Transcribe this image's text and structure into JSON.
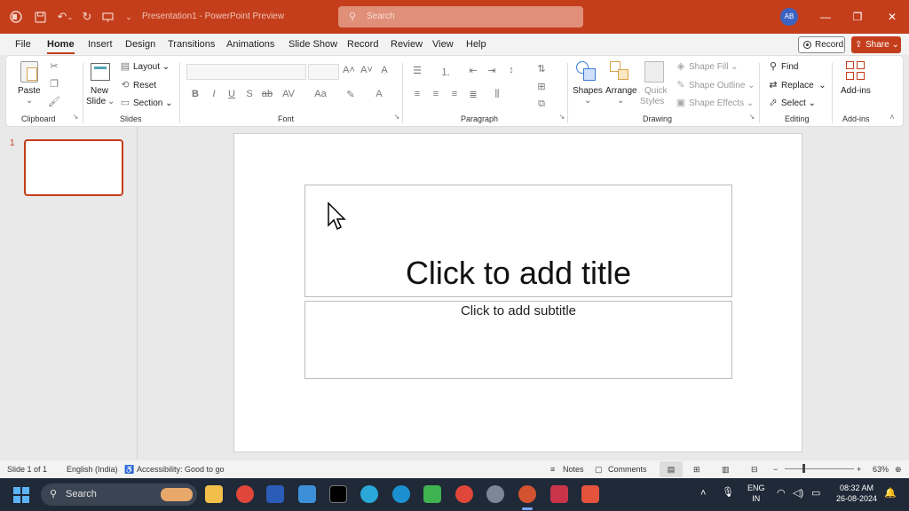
{
  "app": {
    "doc_title": "Presentation1  -  PowerPoint Preview",
    "search_placeholder": "Search",
    "avatar_initials": "AB",
    "accent": "#c43e1c"
  },
  "tabs": [
    "File",
    "Home",
    "Insert",
    "Design",
    "Transitions",
    "Animations",
    "Slide Show",
    "Record",
    "Review",
    "View",
    "Help"
  ],
  "actions": {
    "record": "Record",
    "share": "Share"
  },
  "ribbon": {
    "clipboard": {
      "label": "Clipboard",
      "paste": "Paste"
    },
    "slides": {
      "label": "Slides",
      "new_slide_1": "New",
      "new_slide_2": "Slide",
      "layout": "Layout",
      "reset": "Reset",
      "section": "Section"
    },
    "font": {
      "label": "Font"
    },
    "paragraph": {
      "label": "Paragraph"
    },
    "drawing": {
      "label": "Drawing",
      "shapes": "Shapes",
      "arrange": "Arrange",
      "quick_1": "Quick",
      "quick_2": "Styles",
      "shape_fill": "Shape Fill",
      "shape_outline": "Shape Outline",
      "shape_effects": "Shape Effects"
    },
    "editing": {
      "label": "Editing",
      "find": "Find",
      "replace": "Replace",
      "select": "Select"
    },
    "addins": {
      "label": "Add-ins",
      "addins": "Add-ins"
    }
  },
  "slide_panel": {
    "number": "1"
  },
  "slide": {
    "title_placeholder": "Click to add title",
    "subtitle_placeholder": "Click to add subtitle"
  },
  "status": {
    "slide": "Slide 1 of 1",
    "language": "English (India)",
    "accessibility": "Accessibility: Good to go",
    "notes": "Notes",
    "comments": "Comments",
    "zoom": "63%"
  },
  "taskbar": {
    "search": "Search",
    "lang_1": "ENG",
    "lang_2": "IN",
    "time": "08:32 AM",
    "date": "26-08-2024"
  }
}
